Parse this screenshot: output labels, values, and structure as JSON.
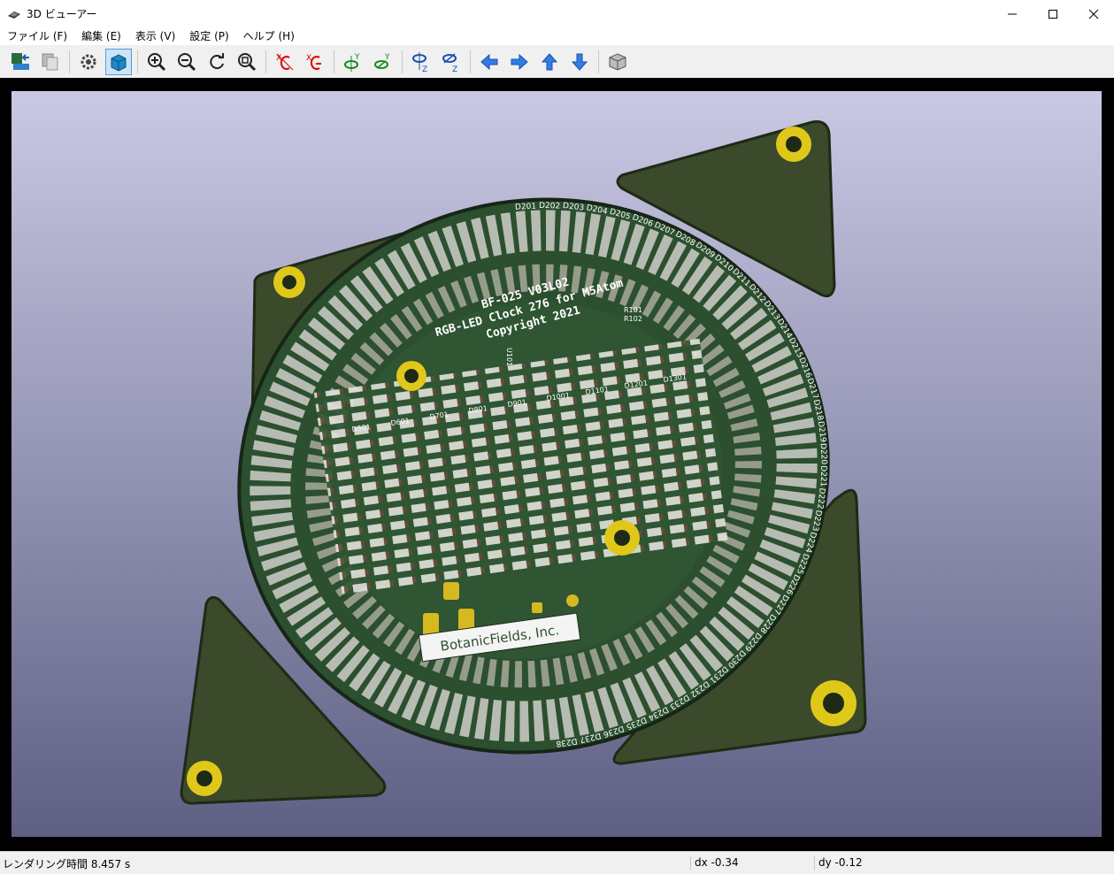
{
  "window": {
    "title": "3D ビューアー"
  },
  "menu": [
    {
      "label": "ファイル (F)"
    },
    {
      "label": "編集 (E)"
    },
    {
      "label": "表示 (V)"
    },
    {
      "label": "設定 (P)"
    },
    {
      "label": "ヘルプ (H)"
    }
  ],
  "toolbar": {
    "icons": [
      "reload-board-icon",
      "copy-image-icon",
      "settings-icon",
      "raytracing-icon",
      "zoom-in-icon",
      "zoom-out-icon",
      "redraw-icon",
      "zoom-fit-icon",
      "rotate-x-cw-icon",
      "rotate-x-ccw-icon",
      "rotate-y-cw-icon",
      "rotate-y-ccw-icon",
      "rotate-z-cw-icon",
      "rotate-z-ccw-icon",
      "move-left-icon",
      "move-right-icon",
      "move-up-icon",
      "move-down-icon",
      "ortho-view-icon"
    ]
  },
  "board": {
    "silk_line1": "BF-025 V03L02",
    "silk_line2": "RGB-LED Clock 276 for M5Atom",
    "silk_line3": "Copyright 2021",
    "company": "BotanicFields, Inc.",
    "ring_labels": [
      "D201",
      "D202",
      "D203",
      "D204",
      "D205",
      "D206",
      "D207",
      "D208",
      "D209",
      "D210",
      "D211",
      "D212",
      "D213",
      "D214",
      "D215",
      "D216",
      "D217",
      "D218",
      "D219",
      "D220",
      "D221",
      "D222",
      "D223",
      "D224",
      "D225",
      "D226",
      "D227",
      "D228",
      "D229",
      "D230",
      "D231",
      "D232",
      "D233",
      "D234",
      "D235",
      "D236",
      "D237",
      "D238"
    ],
    "matrix_labels": [
      "D501",
      "D601",
      "D701",
      "D801",
      "D901",
      "D1001",
      "D1101",
      "D1201",
      "D1301"
    ],
    "part_labels": [
      "R101",
      "R102",
      "U101"
    ]
  },
  "status": {
    "render_time": "レンダリング時間 8.457 s",
    "dx": "dx -0.34",
    "dy": "dy -0.12"
  }
}
